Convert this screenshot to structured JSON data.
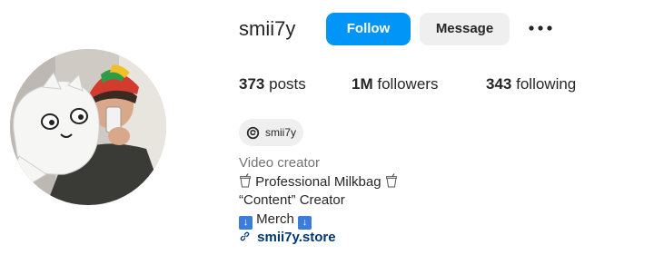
{
  "profile": {
    "username": "smii7y",
    "follow_label": "Follow",
    "message_label": "Message",
    "more_icon": "more-options-icon"
  },
  "stats": {
    "posts_count": "373",
    "posts_label": "posts",
    "followers_count": "1M",
    "followers_label": "followers",
    "following_count": "343",
    "following_label": "following"
  },
  "threads": {
    "handle": "smii7y",
    "icon": "threads-icon"
  },
  "bio": {
    "category": "Video creator",
    "line1_text": "Professional Milkbag",
    "line2_text": "“Content” Creator",
    "line3_text": "Merch",
    "link_text": "smii7y.store",
    "cup_emoji": "cup-with-straw-icon",
    "arrow_emoji": "down-arrow-icon",
    "link_icon": "link-icon"
  },
  "colors": {
    "follow_button": "#0095f6",
    "message_button": "#efefef",
    "link": "#00376b",
    "category": "#737373"
  }
}
